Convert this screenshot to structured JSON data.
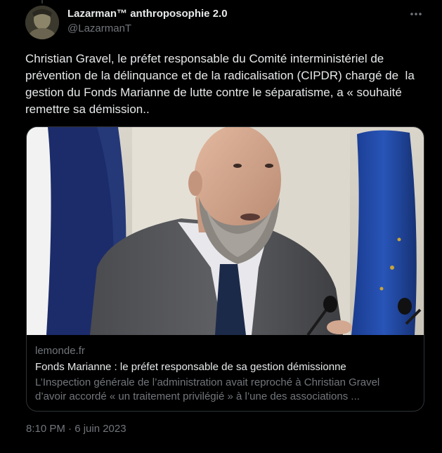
{
  "author": {
    "display_name": "Lazarman™ anthroposophie 2.0",
    "handle": "@LazarmanT",
    "avatar_icon": "avatar"
  },
  "more_icon": "more-horizontal-icon",
  "tweet": {
    "text": "Christian Gravel, le préfet responsable du Comité interministériel de\nprévention de la délinquance et de la radicalisation (CIPDR) chargé de  la\ngestion du Fonds Marianne de lutte contre le séparatisme, a « souhaité\nremettre sa démission..",
    "timestamp": "8:10 PM · 6 juin 2023"
  },
  "link_card": {
    "domain": "lemonde.fr",
    "title": "Fonds Marianne : le préfet responsable de sa gestion démissionne",
    "description_line1": "L’Inspection générale de l’administration avait reproché à Christian Gravel",
    "description_line2": "d’avoir accordé « un traitement privilégié » à l’une des associations ..."
  },
  "colors": {
    "background": "#000000",
    "text_primary": "#e7e9ea",
    "text_secondary": "#71767b",
    "border": "#2f3336",
    "eu_blue": "#1f4aa3",
    "french_blue": "#1a2a66"
  }
}
